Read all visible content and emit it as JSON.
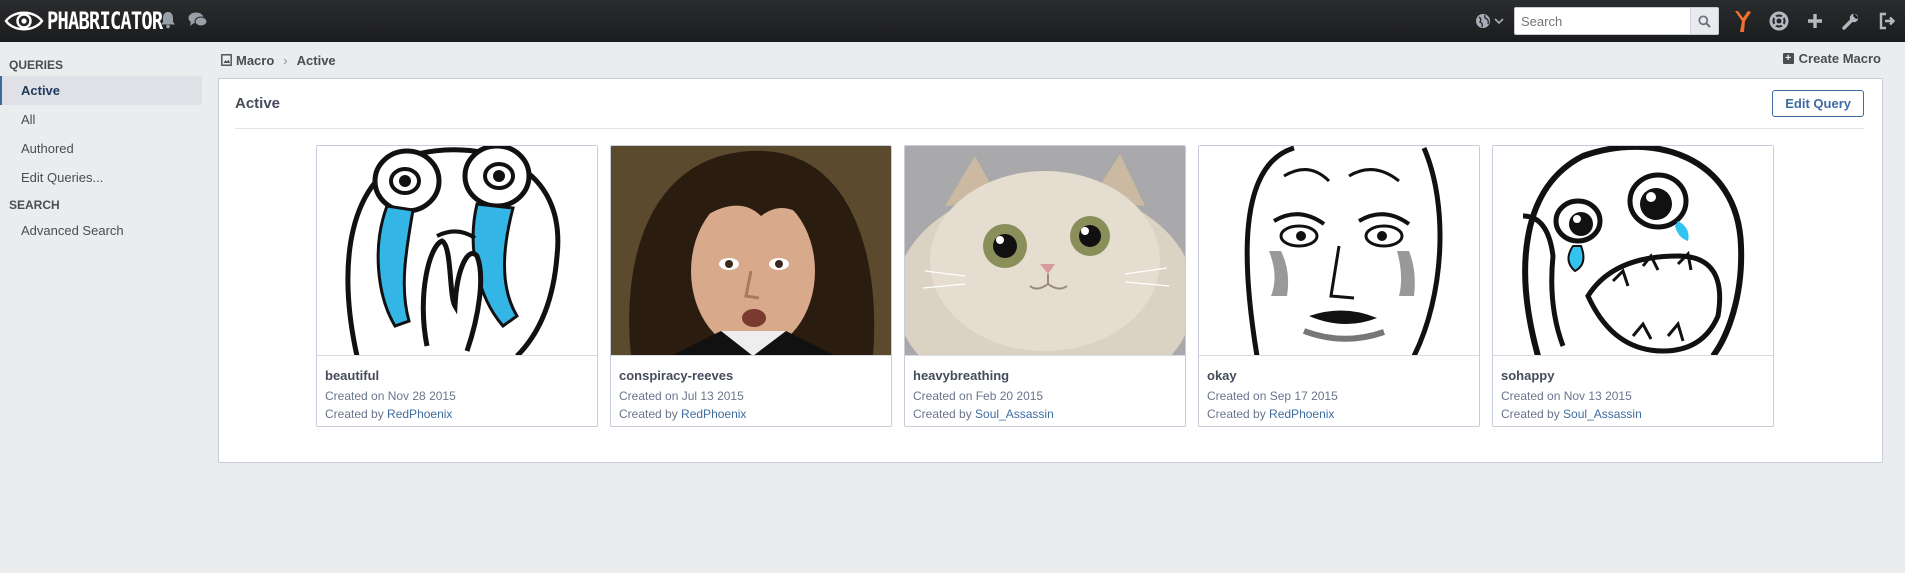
{
  "app": {
    "name": "PHABRICATOR",
    "logo_icon": "eye-icon"
  },
  "topbar": {
    "search_placeholder": "Search",
    "icons": [
      "bell-icon",
      "chat-icon",
      "globe-icon",
      "search-icon",
      "phacility-icon",
      "help-ring-icon",
      "plus-icon",
      "wrench-icon",
      "logout-icon"
    ]
  },
  "sidebar": {
    "queries_header": "QUERIES",
    "items": [
      {
        "label": "Active",
        "active": true
      },
      {
        "label": "All"
      },
      {
        "label": "Authored"
      },
      {
        "label": "Edit Queries..."
      }
    ],
    "search_header": "SEARCH",
    "search_items": [
      {
        "label": "Advanced Search"
      }
    ]
  },
  "crumbs": {
    "root": "Macro",
    "separator": "›",
    "current": "Active"
  },
  "actions": {
    "create_macro": "Create Macro",
    "edit_query": "Edit Query"
  },
  "panel": {
    "title": "Active"
  },
  "macros": [
    {
      "name": "beautiful",
      "created_on": "Created on Nov 28 2015",
      "created_by_prefix": "Created by",
      "author": "RedPhoenix"
    },
    {
      "name": "conspiracy-reeves",
      "created_on": "Created on Jul 13 2015",
      "created_by_prefix": "Created by",
      "author": "RedPhoenix"
    },
    {
      "name": "heavybreathing",
      "created_on": "Created on Feb 20 2015",
      "created_by_prefix": "Created by",
      "author": "Soul_Assassin"
    },
    {
      "name": "okay",
      "created_on": "Created on Sep 17 2015",
      "created_by_prefix": "Created by",
      "author": "RedPhoenix"
    },
    {
      "name": "sohappy",
      "created_on": "Created on Nov 13 2015",
      "created_by_prefix": "Created by",
      "author": "Soul_Assassin"
    }
  ],
  "colors": {
    "topbar": "#1f2022",
    "accent": "#3e6ca1",
    "page_bg": "#ebecee"
  }
}
